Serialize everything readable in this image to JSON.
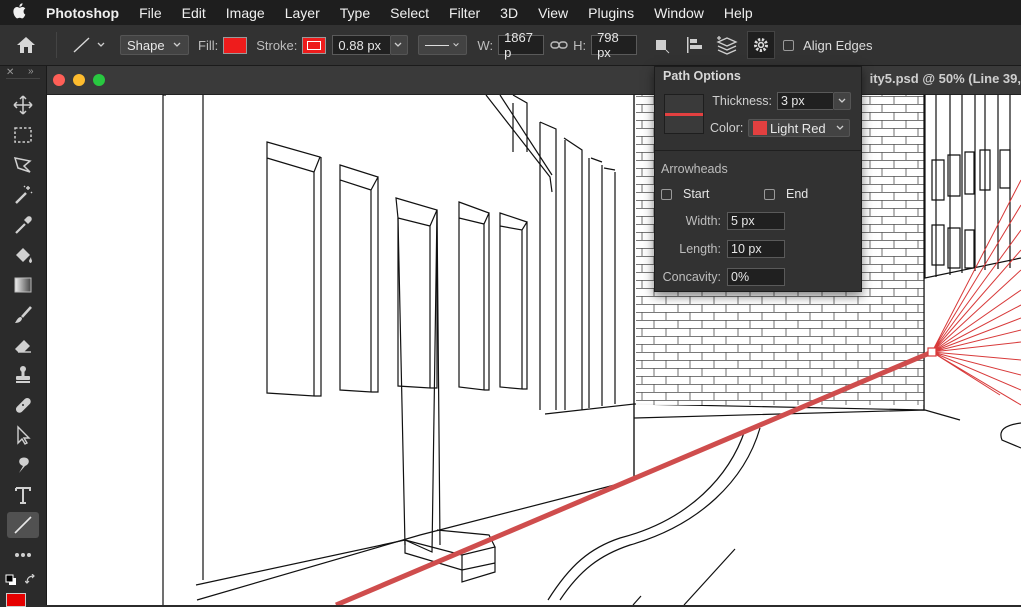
{
  "menubar": {
    "app_name": "Photoshop",
    "items": [
      "File",
      "Edit",
      "Image",
      "Layer",
      "Type",
      "Select",
      "Filter",
      "3D",
      "View",
      "Plugins",
      "Window",
      "Help"
    ]
  },
  "options": {
    "mode": "Shape",
    "fill_label": "Fill:",
    "fill_color": "#ee1c1c",
    "stroke_label": "Stroke:",
    "stroke_width": "0.88 px",
    "w_label": "W:",
    "w_value": "1867 p",
    "h_label": "H:",
    "h_value": "798 px",
    "align_edges": "Align Edges"
  },
  "document": {
    "title": "ity5.psd @ 50% (Line 39,"
  },
  "path_options": {
    "title": "Path Options",
    "thickness_label": "Thickness:",
    "thickness_value": "3 px",
    "color_label": "Color:",
    "color_value": "Light Red",
    "color_hex": "#e34040",
    "arrowheads_label": "Arrowheads",
    "start_label": "Start",
    "end_label": "End",
    "width_label": "Width:",
    "width_value": "5 px",
    "length_label": "Length:",
    "length_value": "10 px",
    "concavity_label": "Concavity:",
    "concavity_value": "0%"
  },
  "colors": {
    "foreground": "#e60000",
    "accent_line": "#cf4d4d"
  }
}
